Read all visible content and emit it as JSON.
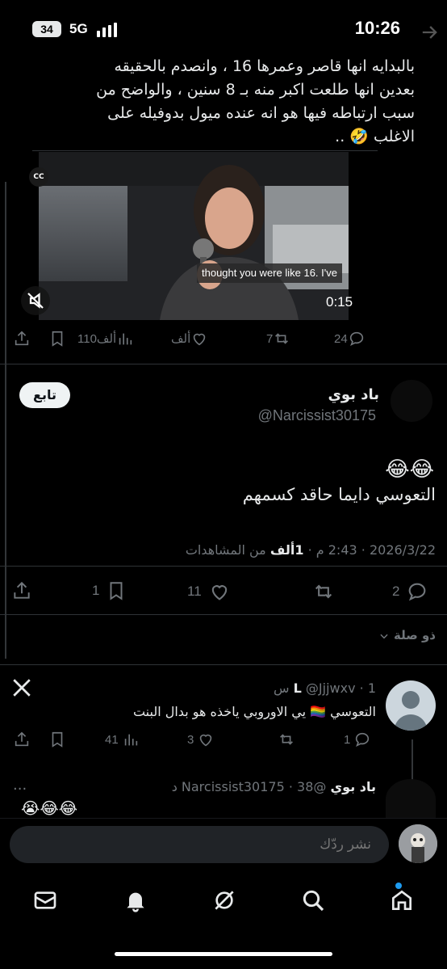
{
  "status_bar": {
    "time": "10:26",
    "battery": "34",
    "network": "5G"
  },
  "quoted_tweet": {
    "text_lines": [
      "بالبدايه انها قاصر وعمرها 16 ، وانصدم بالحقيقه",
      "بعدين انها طلعت اكبر منه بـ 8 سنين ، والواضح من",
      "سبب ارتباطه فيها هو انه عنده ميول بدوفيله على",
      "الاغلب 🤣 .."
    ],
    "video": {
      "cc_label": "CC",
      "subtitle": "thought you were like 16. I've",
      "duration": "0:15"
    },
    "actions": {
      "replies": "24",
      "reposts": "7",
      "likes": "ألف",
      "views": "110ألف"
    }
  },
  "main_tweet": {
    "follow_label": "تابع",
    "author_name": "باد بوي",
    "author_handle": "@Narcissist30175",
    "emoji": "😂😂",
    "text": "التعوسي دايما حاقد كسمهم",
    "meta_date": "2026/3/22 · 2:43 م · ",
    "meta_views_count": "1ألف",
    "meta_views_label": " من المشاهدات",
    "actions": {
      "replies": "2",
      "reposts": "",
      "likes": "11",
      "bookmarks": "1"
    },
    "sort_label": "ذو صلة"
  },
  "replies": [
    {
      "name": "L",
      "handle": "@Jjjwxv",
      "time": "· 1 س",
      "text": "التعوسي 🏳️‍🌈 يي الاوروبي ياخذه هو بدال البنت",
      "actions": {
        "replies": "1",
        "reposts": "",
        "likes": "3",
        "views": "41"
      }
    },
    {
      "name": "باد بوي",
      "handle": "@Narcissist30175",
      "time": "· 38 د",
      "emoji": "😭😂😂",
      "more": "···"
    }
  ],
  "reply_box": {
    "placeholder": "نشر ردّك"
  },
  "colors": {
    "background": "#000000",
    "text": "#e7e9ea",
    "muted": "#71767b",
    "accent": "#1d9bf0"
  },
  "icons": {
    "tabs": [
      "mail-icon",
      "bell-icon",
      "grok-icon",
      "search-icon",
      "home-icon"
    ]
  }
}
